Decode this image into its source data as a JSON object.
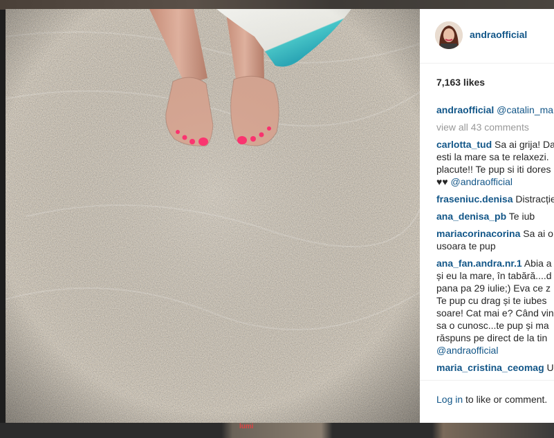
{
  "post": {
    "username": "andraofficial",
    "likes": "7,163 likes",
    "caption": {
      "user": "andraofficial",
      "mention": "@catalin_ma"
    },
    "view_all": "view all 43 comments",
    "comments": [
      {
        "user": "carlotta_tud",
        "lines": [
          "Sa ai grija! Da",
          "esti la mare sa te relaxezi.",
          "placute!! Te pup si iti dores",
          "♥♥ "
        ],
        "mention": "@andraofficial"
      },
      {
        "user": "fraseniuc.denisa",
        "lines": [
          "Distracție"
        ]
      },
      {
        "user": "ana_denisa_pb",
        "lines": [
          "Te iub"
        ]
      },
      {
        "user": "mariacorinacorina",
        "lines": [
          "Sa ai o",
          "usoara te pup"
        ]
      },
      {
        "user": "ana_fan.andra.nr.1",
        "lines": [
          "Abia a",
          "și eu la mare, în tabără....d",
          "pana pa 29 iulie;) Eva ce z",
          "Te pup cu drag și te iubes",
          "soare! Cat mai e? Când vin",
          "sa o cunosc...te pup și ma",
          "răspuns pe direct de la tin"
        ],
        "mention": "@andraofficial"
      },
      {
        "user": "maria_cristina_ceomag",
        "lines": [
          "U"
        ]
      }
    ],
    "footer": {
      "login": "Log in",
      "rest": " to like or comment."
    }
  },
  "background": {
    "bottom_text": "lumi"
  },
  "colors": {
    "link": "#125688",
    "text": "#262626",
    "muted": "#999999",
    "nail": "#ff2a6a"
  }
}
